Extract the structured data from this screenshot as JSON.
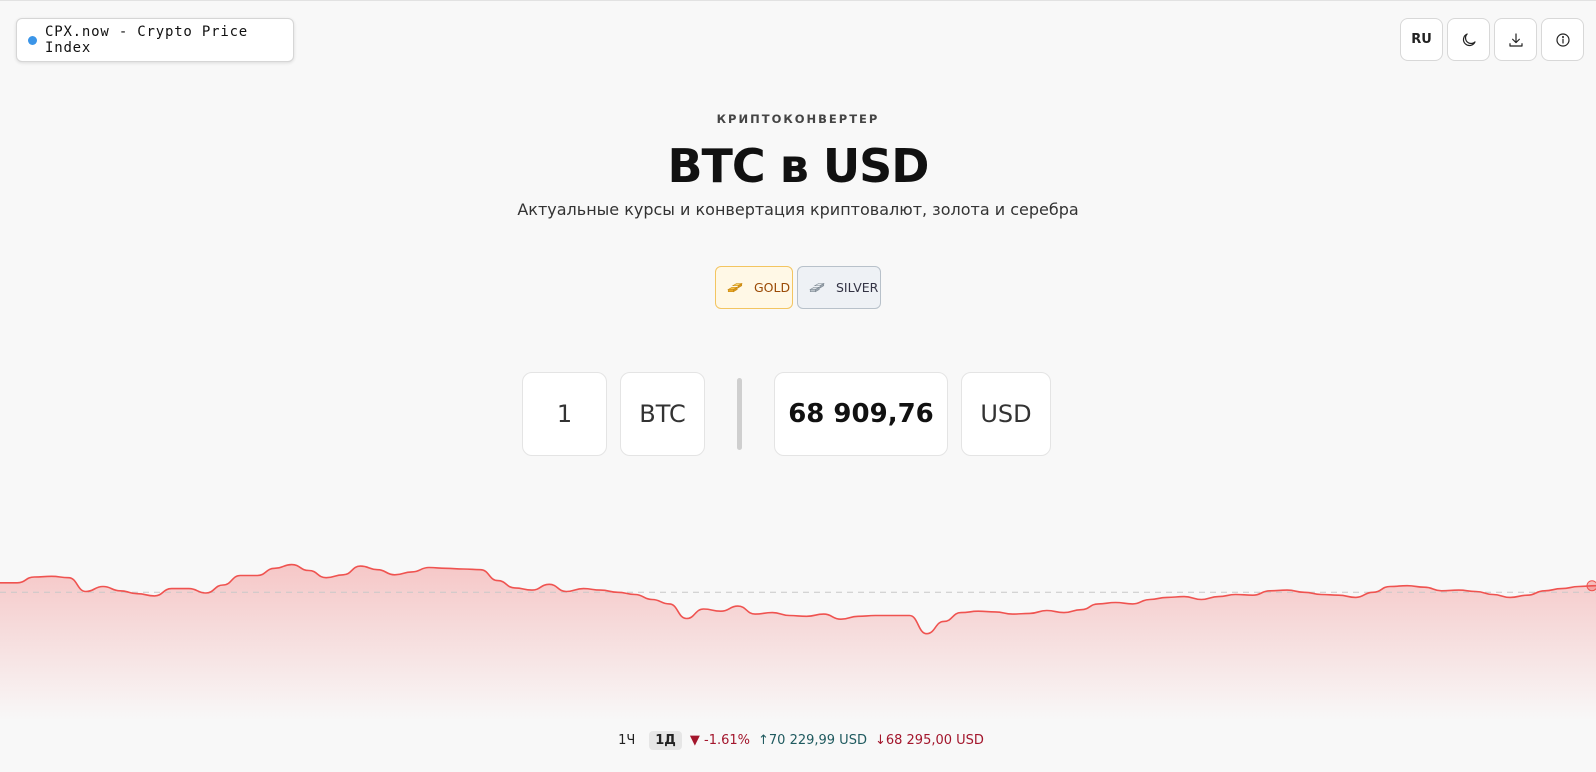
{
  "brand": {
    "name": "CPX.now - Crypto Price Index",
    "dot_color": "#3b95e8"
  },
  "toolbar": {
    "lang": "RU",
    "theme_icon": "moon-icon",
    "download_icon": "download-icon",
    "info_icon": "info-icon"
  },
  "hero": {
    "eyebrow": "КРИПТОКОНВЕРТЕР",
    "title": "BTC в USD",
    "subtitle": "Актуальные курсы и конвертация криптовалют, золота и серебра"
  },
  "chips": [
    {
      "label": "GOLD",
      "icon": "gold-bars-icon"
    },
    {
      "label": "SILVER",
      "icon": "silver-bars-icon"
    }
  ],
  "converter": {
    "amount": "1",
    "from": "BTC",
    "result": "68 909,76",
    "to": "USD"
  },
  "chart_data": {
    "type": "area",
    "title": "",
    "xlabel": "",
    "ylabel": "",
    "ylim": [
      68150,
      70350
    ],
    "baseline": 69920,
    "color": "#ef5350",
    "series": [
      {
        "name": "",
        "values": [
          70050,
          70050,
          70130,
          70140,
          70120,
          69930,
          70000,
          69940,
          69900,
          69870,
          69970,
          69970,
          69910,
          70020,
          70150,
          70150,
          70250,
          70300,
          70220,
          70120,
          70160,
          70280,
          70230,
          70160,
          70200,
          70260,
          70250,
          70240,
          70230,
          70080,
          69980,
          69950,
          70030,
          69930,
          69970,
          69950,
          69920,
          69890,
          69820,
          69760,
          69560,
          69690,
          69660,
          69730,
          69620,
          69640,
          69600,
          69590,
          69620,
          69550,
          69590,
          69600,
          69600,
          69600,
          69350,
          69520,
          69640,
          69660,
          69650,
          69620,
          69630,
          69670,
          69640,
          69680,
          69760,
          69780,
          69760,
          69820,
          69850,
          69860,
          69820,
          69860,
          69890,
          69880,
          69940,
          69950,
          69920,
          69890,
          69880,
          69850,
          69920,
          70000,
          70010,
          69990,
          69940,
          69950,
          69930,
          69890,
          69850,
          69880,
          69940,
          69970,
          70000,
          70010
        ]
      }
    ]
  },
  "stats": {
    "tf_1h": "1Ч",
    "tf_1d": "1Д",
    "change": "▼ -1.61%",
    "high": "↑70 229,99 USD",
    "low": "↓68 295,00 USD"
  }
}
